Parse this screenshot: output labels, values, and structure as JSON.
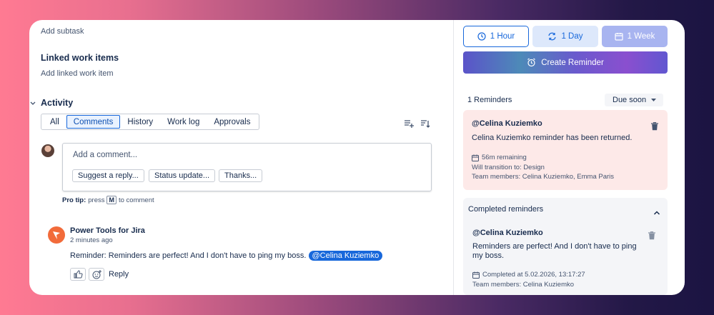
{
  "left": {
    "add_subtask": "Add subtask",
    "linked_title": "Linked work items",
    "add_linked": "Add linked work item",
    "activity_title": "Activity",
    "tabs": [
      "All",
      "Comments",
      "History",
      "Work log",
      "Approvals"
    ],
    "comment_placeholder": "Add a comment...",
    "suggestions": [
      "Suggest a reply...",
      "Status update...",
      "Thanks..."
    ],
    "pro_tip_label": "Pro tip:",
    "pro_tip_press": "press",
    "pro_tip_key": "M",
    "pro_tip_rest": "to comment",
    "comment": {
      "author": "Power Tools for Jira",
      "time": "2 minutes ago",
      "text": "Reminder: Reminders are perfect! And I don't have to ping my boss.",
      "mention": "@Celina Kuziemko",
      "reply": "Reply"
    }
  },
  "right": {
    "time_buttons": [
      "1 Hour",
      "1 Day",
      "1 Week"
    ],
    "create_reminder": "Create Reminder",
    "reminders_count": "1 Reminders",
    "sort": "Due soon",
    "active_reminder": {
      "user": "@Celina Kuziemko",
      "message": "Celina Kuziemko reminder has been returned.",
      "remaining": "56m remaining",
      "transition": "Will transition to: Design",
      "team": "Team members: Celina Kuziemko, Emma Paris"
    },
    "completed_title": "Completed reminders",
    "completed_reminder": {
      "user": "@Celina Kuziemko",
      "message_line1": "Reminders are perfect! And I don't have to ping",
      "message_line2": "my boss.",
      "completed_at": "Completed at 5.02.2026, 13:17:27",
      "team": "Team members: Celina Kuziemko"
    }
  },
  "colors": {
    "accent": "#1868db",
    "reminder_bg": "#fde9e8",
    "completed_bg": "#f4f5f8"
  }
}
